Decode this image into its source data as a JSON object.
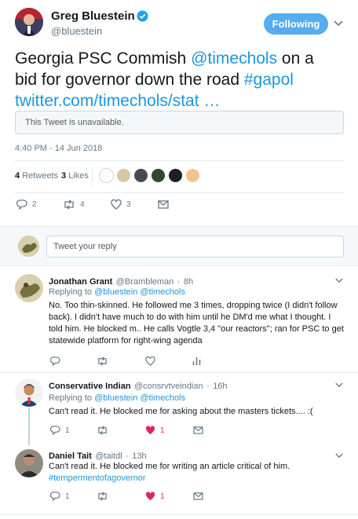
{
  "author": {
    "name": "Greg Bluestein",
    "handle": "@bluestein"
  },
  "follow_button": "Following",
  "tweet": {
    "text_before": "Georgia PSC Commish ",
    "mention": "@timechols",
    "text_middle": " on a bid for governor down the road ",
    "hashtag": "#gapol",
    "link": "twitter.com/timechols/stat …"
  },
  "quoted_tweet": "This Tweet is unavailable.",
  "timestamp": "4:40 PM - 14 Jun 2018",
  "stats": {
    "retweets_count": "4",
    "retweets_label": "Retweets",
    "likes_count": "3",
    "likes_label": "Likes"
  },
  "actions": {
    "replies": "2",
    "retweets": "4",
    "likes": "3"
  },
  "reply_placeholder": "Tweet your reply",
  "replies": [
    {
      "name": "Jonathan Grant",
      "handle": "@Brambleman",
      "time": "8h",
      "replying_label": "Replying to",
      "replying_to": "@bluestein @timechols",
      "text": "No. Too thin-skinned. He followed me 3 times, dropping twice (I didn't follow back).   I didn't have much to do with him until he DM'd me what I thought. I told him. He blocked m.. He calls Vogtle 3,4 \"our reactors\"; ran for PSC to get statewide platform for right-wing agenda"
    },
    {
      "name": "Conservative Indian",
      "handle": "@consrvtveindian",
      "time": "16h",
      "replying_label": "Replying to",
      "replying_to": "@bluestein @timechols",
      "text": "Can't read it. He blocked me for asking about the masters tickets.... :(",
      "reply_count": "1",
      "like_count": "1"
    },
    {
      "name": "Daniel Tait",
      "handle": "@taitdl",
      "time": "13h",
      "text": "Can't read it. He blocked me for writing an article critical of him.",
      "hashtag": "#tempermentofagovernor",
      "reply_count": "1",
      "like_count": "1"
    }
  ]
}
